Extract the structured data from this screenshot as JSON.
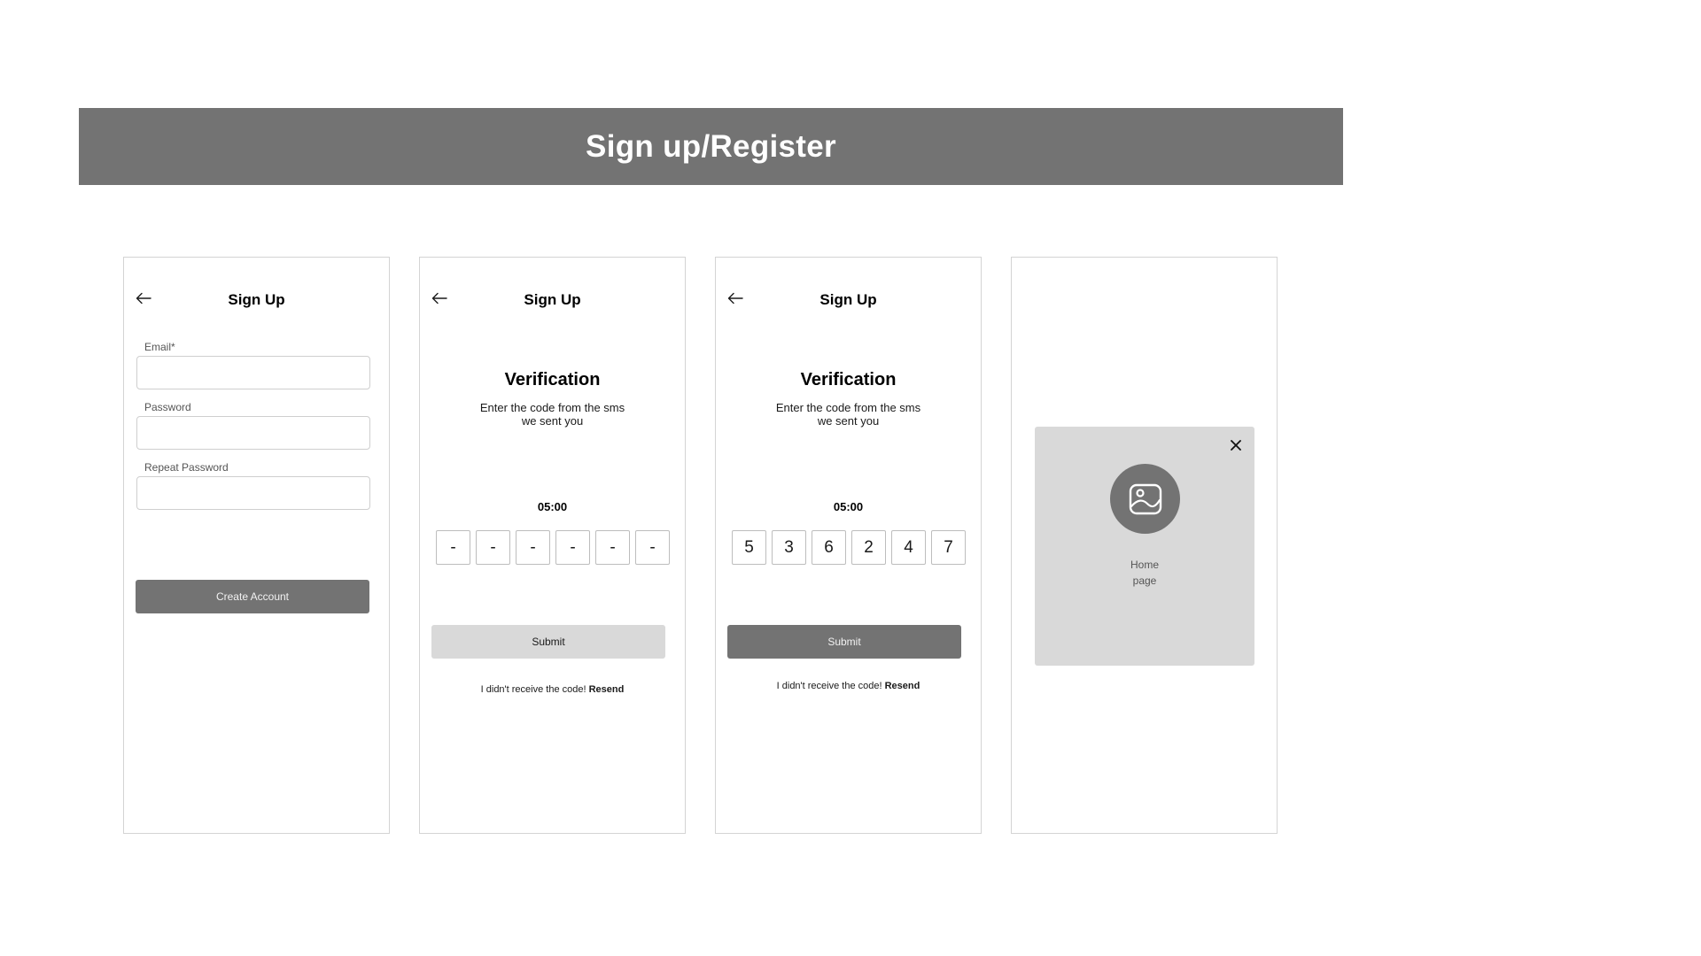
{
  "banner": {
    "title": "Sign up/Register"
  },
  "screen1": {
    "title": "Sign Up",
    "fields": [
      {
        "label": "Email*",
        "value": ""
      },
      {
        "label": "Password",
        "value": ""
      },
      {
        "label": "Repeat Password",
        "value": ""
      }
    ],
    "button": "Create Account"
  },
  "screen2": {
    "title": "Sign Up",
    "heading": "Verification",
    "subtitle_line1": "Enter the code from the sms",
    "subtitle_line2": "we sent you",
    "timer": "05:00",
    "code": [
      "-",
      "-",
      "-",
      "-",
      "-",
      "-"
    ],
    "button": "Submit",
    "resend_text": "I didn't receive the code!",
    "resend_link": "Resend"
  },
  "screen3": {
    "title": "Sign Up",
    "heading": "Verification",
    "subtitle_line1": "Enter the code from the sms",
    "subtitle_line2": "we sent you",
    "timer": "05:00",
    "code": [
      "5",
      "3",
      "6",
      "2",
      "4",
      "7"
    ],
    "button": "Submit",
    "resend_text": "I didn't receive the code!",
    "resend_link": "Resend"
  },
  "screen4": {
    "modal_text_line1": "Home",
    "modal_text_line2": "page"
  },
  "colors": {
    "banner": "#737373",
    "button_active": "#737373",
    "button_disabled": "#d9d9d9",
    "modal_bg": "#d9d9d9",
    "border": "#d4d4d4"
  },
  "icons": {
    "back": "arrow-left-icon",
    "close": "close-icon",
    "image": "image-placeholder-icon"
  }
}
